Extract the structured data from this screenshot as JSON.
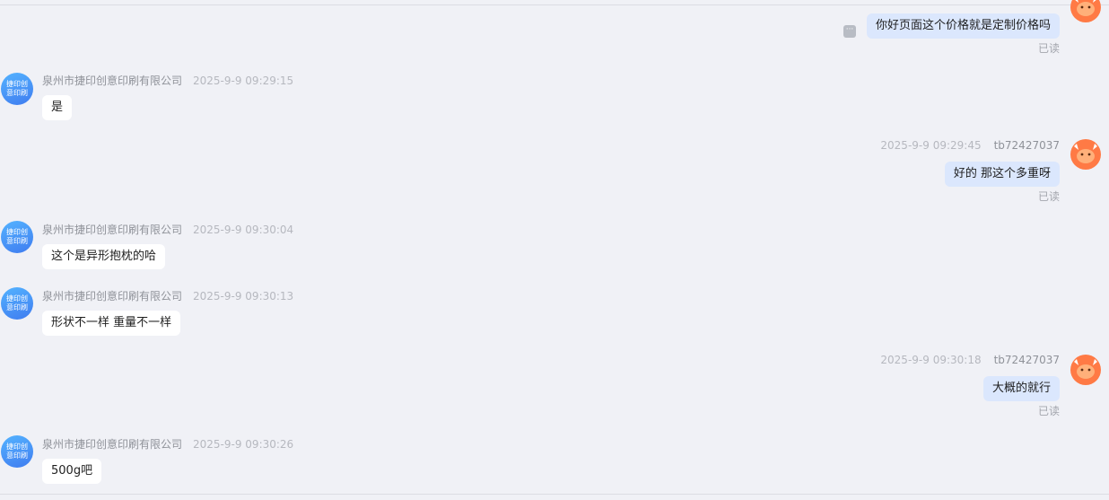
{
  "shop": {
    "name": "泉州市捷印创意印刷有限公司",
    "avatar_line1": "捷印创",
    "avatar_line2": "意印刷"
  },
  "user": {
    "name": "tb72427037"
  },
  "read_label": "已读",
  "messages": [
    {
      "side": "user",
      "time": "",
      "text": "你好页面这个价格就是定制价格吗"
    },
    {
      "side": "shop",
      "time": "2025-9-9 09:29:15",
      "text": "是"
    },
    {
      "side": "user",
      "time": "2025-9-9 09:29:45",
      "text": "好的 那这个多重呀"
    },
    {
      "side": "shop",
      "time": "2025-9-9 09:30:04",
      "text": "这个是异形抱枕的哈"
    },
    {
      "side": "shop",
      "time": "2025-9-9 09:30:13",
      "text": "形状不一样 重量不一样"
    },
    {
      "side": "user",
      "time": "2025-9-9 09:30:18",
      "text": "大概的就行"
    },
    {
      "side": "shop",
      "time": "2025-9-9 09:30:26",
      "text": "500g吧"
    }
  ],
  "colors": {
    "background": "#f0f1f6",
    "user_bubble": "#dbe7fd",
    "shop_bubble": "#ffffff",
    "shop_avatar": "#4a90f5",
    "user_avatar": "#ff7a45"
  }
}
